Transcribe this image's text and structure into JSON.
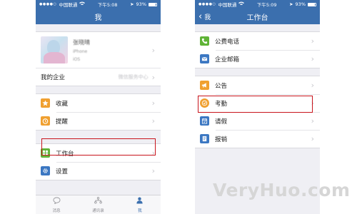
{
  "status_bar": {
    "carrier": "中国联通",
    "battery": "93%",
    "left_time": "下午5:08",
    "right_time": "下午5:09"
  },
  "left": {
    "title": "我",
    "profile": {
      "name": "张晓晴",
      "line1": "iPhone",
      "line2": "iOS"
    },
    "enterprise": {
      "label": "我的企业",
      "value": "微信服务中心"
    },
    "items": [
      {
        "label": "收藏",
        "icon": "star-icon",
        "color": "#f0a030"
      },
      {
        "label": "提醒",
        "icon": "alarm-icon",
        "color": "#f0a030"
      }
    ],
    "workbench": {
      "label": "工作台",
      "icon": "grid-icon",
      "color": "#5fb336"
    },
    "settings": {
      "label": "设置",
      "icon": "gear-icon",
      "color": "#3b77c2"
    },
    "tabs": [
      {
        "label": "消息",
        "icon": "message-icon"
      },
      {
        "label": "通讯录",
        "icon": "contacts-icon"
      },
      {
        "label": "我",
        "icon": "person-icon"
      }
    ]
  },
  "right": {
    "back_label": "我",
    "title": "工作台",
    "group1": [
      {
        "label": "公费电话",
        "icon": "phone-icon",
        "color": "#5fb336"
      },
      {
        "label": "企业邮箱",
        "icon": "mail-icon",
        "color": "#3b77c2"
      }
    ],
    "group2": [
      {
        "label": "公告",
        "icon": "megaphone-icon",
        "color": "#f0a030"
      },
      {
        "label": "考勤",
        "icon": "clock-icon",
        "color": "#f0a030"
      },
      {
        "label": "请假",
        "icon": "calendar-icon",
        "color": "#3b77c2"
      },
      {
        "label": "报销",
        "icon": "receipt-icon",
        "color": "#3b77c2"
      }
    ]
  },
  "watermark": "VeryHuo.com"
}
